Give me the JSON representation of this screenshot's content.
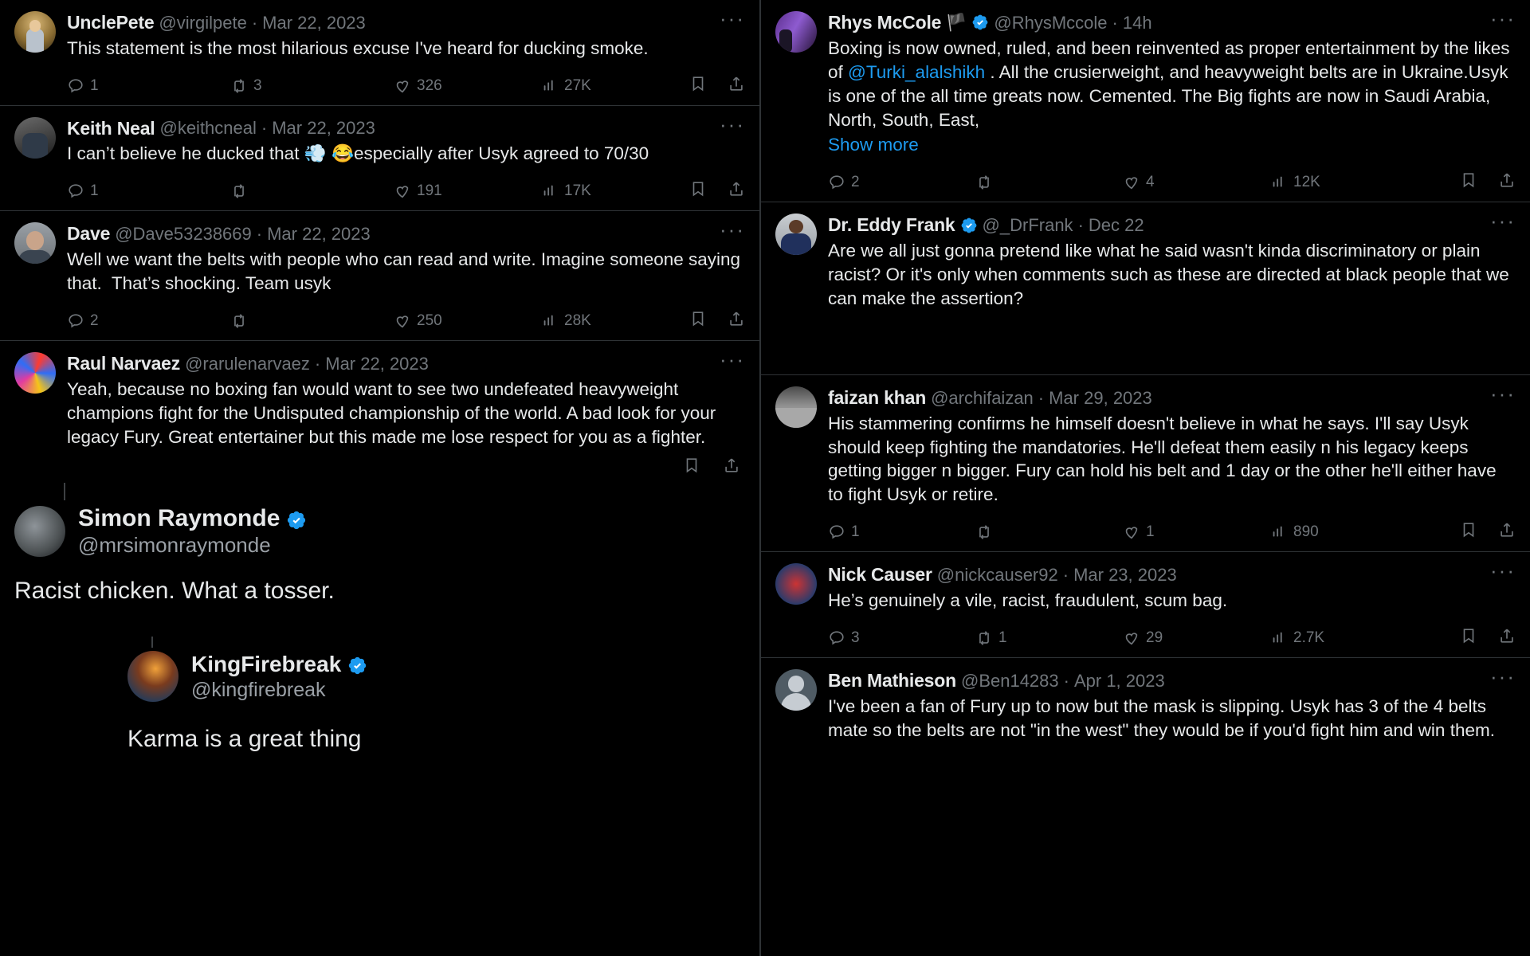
{
  "app": {
    "theme": "dark",
    "accent": "#1d9bf0",
    "text_color": "#e7e9ea",
    "muted_color": "#71767b",
    "border_color": "#2f3336"
  },
  "icons": {
    "reply": "reply-icon",
    "retweet": "retweet-icon",
    "like": "like-icon",
    "views": "views-icon",
    "bookmark": "bookmark-icon",
    "share": "share-icon",
    "more": "more-options-icon",
    "verified": "verified-badge-icon"
  },
  "left_column": {
    "tweets": [
      {
        "display_name": "UnclePete",
        "handle": "@virgilpete",
        "separator": "·",
        "timestamp": "Mar 22, 2023",
        "text": "This statement is the most hilarious excuse I've heard for ducking smoke.",
        "verified": false,
        "stats": {
          "replies": "1",
          "retweets": "3",
          "likes": "326",
          "views": "27K"
        },
        "more_label": "···"
      },
      {
        "display_name": "Keith Neal",
        "handle": "@keithcneal",
        "separator": "·",
        "timestamp": "Mar 22, 2023",
        "text": "I can’t believe he ducked that 💨 😂especially after Usyk agreed to 70/30",
        "verified": false,
        "stats": {
          "replies": "1",
          "retweets": "",
          "likes": "191",
          "views": "17K"
        },
        "more_label": "···"
      },
      {
        "display_name": "Dave",
        "handle": "@Dave53238669",
        "separator": "·",
        "timestamp": "Mar 22, 2023",
        "text": "Well we want the belts with people who can read and write. Imagine someone saying that.  That’s shocking. Team usyk",
        "verified": false,
        "stats": {
          "replies": "2",
          "retweets": "",
          "likes": "250",
          "views": "28K"
        },
        "more_label": "···"
      },
      {
        "display_name": "Raul Narvaez",
        "handle": "@rarulenarvaez",
        "separator": "·",
        "timestamp": "Mar 22, 2023",
        "text": "Yeah, because no boxing fan would want to see two undefeated heavyweight champions fight for the Undisputed championship of the world. A bad look for your legacy Fury. Great entertainer but this made me lose respect for you as a fighter.",
        "verified": false,
        "stats": {
          "replies": "",
          "retweets": "",
          "likes": "",
          "views": ""
        },
        "more_label": "···"
      }
    ],
    "quote_simon": {
      "display_name": "Simon Raymonde",
      "handle": "@mrsimonraymonde",
      "verified": true,
      "text": "Racist chicken. What a tosser."
    },
    "quote_kingfirebreak": {
      "display_name": "KingFirebreak",
      "handle": "@kingfirebreak",
      "verified": true,
      "text": "Karma is a great thing"
    }
  },
  "right_column": {
    "tweets": [
      {
        "display_name": "Rhys McCole",
        "flag": "🏴",
        "handle": "@RhysMccole",
        "separator": "·",
        "timestamp": "14h",
        "verified": true,
        "text_before_mention": "Boxing is now owned, ruled, and been reinvented as proper entertainment by the likes of ",
        "mention": "@Turki_alalshikh",
        "text_after_mention": " . All the crusierweight, and heavyweight belts are in Ukraine.Usyk is one of the all time greats now. Cemented. The Big fights are now in Saudi Arabia, North, South, East,",
        "show_more": "Show more",
        "stats": {
          "replies": "2",
          "retweets": "",
          "likes": "4",
          "views": "12K"
        },
        "more_label": "···"
      },
      {
        "display_name": "Dr. Eddy Frank",
        "handle": "@_DrFrank",
        "separator": "·",
        "timestamp": "Dec 22",
        "verified": true,
        "text": "Are we all just gonna pretend like what he said wasn't kinda discriminatory or plain racist? Or it's only when comments such as these are directed at black people that we can make the assertion?",
        "stats": {
          "replies": "",
          "retweets": "",
          "likes": "",
          "views": ""
        },
        "more_label": "···"
      },
      {
        "display_name": "faizan khan",
        "handle": "@archifaizan",
        "separator": "·",
        "timestamp": "Mar 29, 2023",
        "verified": false,
        "text": "His stammering confirms he himself doesn't believe in what he says. I'll say Usyk should keep fighting the mandatories. He'll defeat them easily n his legacy keeps getting bigger n bigger. Fury can hold his belt and 1 day or the other he'll either have to fight Usyk or retire.",
        "stats": {
          "replies": "1",
          "retweets": "",
          "likes": "1",
          "views": "890"
        },
        "more_label": "···"
      },
      {
        "display_name": "Nick Causer",
        "handle": "@nickcauser92",
        "separator": "·",
        "timestamp": "Mar 23, 2023",
        "verified": false,
        "text": "He’s genuinely a vile, racist, fraudulent, scum bag.",
        "stats": {
          "replies": "3",
          "retweets": "1",
          "likes": "29",
          "views": "2.7K"
        },
        "more_label": "···"
      },
      {
        "display_name": "Ben Mathieson",
        "handle": "@Ben14283",
        "separator": "·",
        "timestamp": "Apr 1, 2023",
        "verified": false,
        "text": "I've been a fan of Fury up to now but the mask is slipping. Usyk has 3 of the 4 belts mate so the belts are not \"in the west\" they would be if you'd fight him and win them.",
        "stats": {
          "replies": "",
          "retweets": "",
          "likes": "",
          "views": ""
        },
        "more_label": "···"
      }
    ]
  }
}
